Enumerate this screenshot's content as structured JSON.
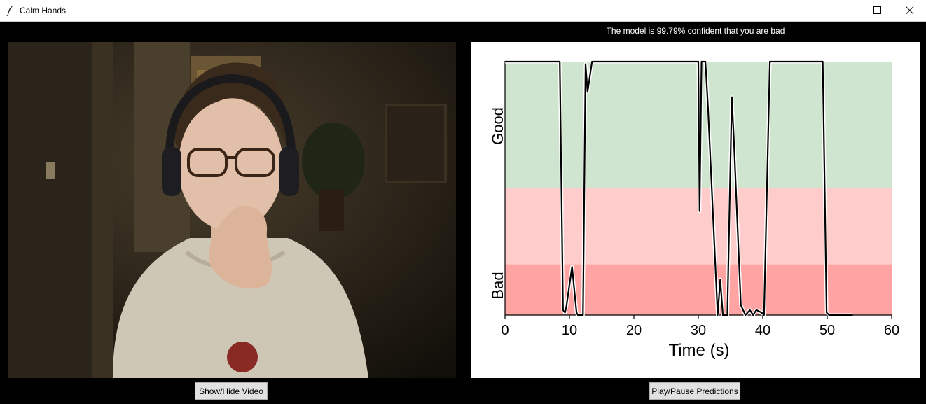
{
  "window": {
    "title": "Calm Hands",
    "icon": "feather-icon",
    "controls": [
      "minimize-icon",
      "maximize-icon",
      "close-icon"
    ]
  },
  "status": {
    "text": "The model is 99.79% confident that you are bad"
  },
  "buttons": {
    "show_hide_video": "Show/Hide Video",
    "play_pause": "Play/Pause Predictions"
  },
  "colors": {
    "good_zone": "#cfe5cf",
    "bad_light_zone": "#ffcccc",
    "bad_zone": "#ffa3a3",
    "line": "#000000"
  },
  "chart_data": {
    "type": "line",
    "title": "",
    "xlabel": "Time (s)",
    "ylabel_top": "Good",
    "ylabel_bottom": "Bad",
    "xlim": [
      0,
      60
    ],
    "ylim": [
      0,
      1
    ],
    "xticks": [
      0,
      10,
      20,
      30,
      40,
      50,
      60
    ],
    "bands": [
      {
        "from": 0.5,
        "to": 1.0,
        "name": "good",
        "color": "#cfe5cf"
      },
      {
        "from": 0.2,
        "to": 0.5,
        "name": "bad-light",
        "color": "#ffcccc"
      },
      {
        "from": 0.0,
        "to": 0.2,
        "name": "bad",
        "color": "#ffa3a3"
      }
    ],
    "series": [
      {
        "x": [
          0,
          8.5,
          9.0,
          9.3,
          9.5,
          10.4,
          11.1,
          11.3,
          12.1,
          12.5,
          12.8,
          13.5,
          14.2,
          30.0,
          30.2,
          30.5,
          31.1,
          31.5,
          33.0,
          33.4,
          33.8,
          34.5,
          35.2,
          35.5,
          36.0,
          36.6,
          37.3,
          38.0,
          38.5,
          39.0,
          39.8,
          40.2,
          41.1,
          49.3,
          49.9,
          50.3,
          51.0,
          54.0
        ],
        "y": [
          1.0,
          1.0,
          0.02,
          0.01,
          0.03,
          0.19,
          0.01,
          0.0,
          0.0,
          0.99,
          0.88,
          1.0,
          1.0,
          1.0,
          0.41,
          1.0,
          1.0,
          0.82,
          0.0,
          0.14,
          0.0,
          0.0,
          0.86,
          0.7,
          0.4,
          0.04,
          0.0,
          0.02,
          0.0,
          0.02,
          0.01,
          0.0,
          1.0,
          1.0,
          0.01,
          0.0,
          0.0,
          0.0
        ]
      }
    ]
  }
}
